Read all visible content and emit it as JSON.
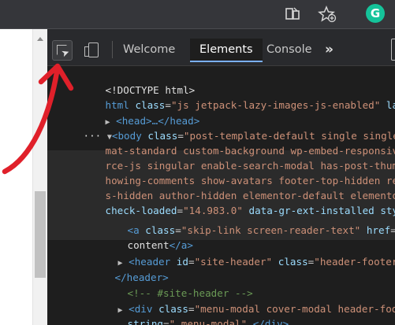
{
  "browser": {
    "toolbar_icons": [
      "read-aloud-icon",
      "add-favorite-icon"
    ],
    "extension_badge": "G"
  },
  "devtools": {
    "tabs": {
      "welcome": "Welcome",
      "elements": "Elements",
      "console": "Console",
      "more": "»"
    },
    "active_tab": "Elements"
  },
  "dom_tree": {
    "l1": "<!DOCTYPE html>",
    "l2_a": "html",
    "l2_b": "class",
    "l2_c": "\"js jetpack-lazy-images-js-enabled\"",
    "l2_d": "lan",
    "l3": "<head>…</head>",
    "l4_a": "<body",
    "l4_b": "class",
    "l4_c": "\"post-template-default single single-",
    "l5": "mat-standard custom-background wp-embed-responsive",
    "l6": "rce-js singular enable-search-modal has-post-thumbn",
    "l7": "howing-comments show-avatars footer-top-hidden redu",
    "l8": "s-hidden author-hidden elementor-default elementor-",
    "l9_a": "check-loaded",
    "l9_b": "\"14.983.0\"",
    "l9_c": "data-gr-ext-installed",
    "l9_d": "style",
    "l10_a": "<a",
    "l10_b": "class",
    "l10_c": "\"skip-link screen-reader-text\"",
    "l10_d": "href",
    "l10_e": "\"#",
    "l11_a": "content",
    "l11_b": "</a>",
    "l12_a": "<header",
    "l12_b": "id",
    "l12_c": "\"site-header\"",
    "l12_d": "class",
    "l12_e": "\"header-footer-g",
    "l13": "</header>",
    "l14": "<!-- #site-header -->",
    "l15_a": "<div",
    "l15_b": "class",
    "l15_c": "\"menu-modal cover-modal header-foote",
    "l16_a": "string",
    "l16_b": "\".menu-modal\"",
    "l16_c": "…",
    "l16_d": "</div>"
  },
  "annotation": {
    "arrow_color": "#e0202a"
  }
}
